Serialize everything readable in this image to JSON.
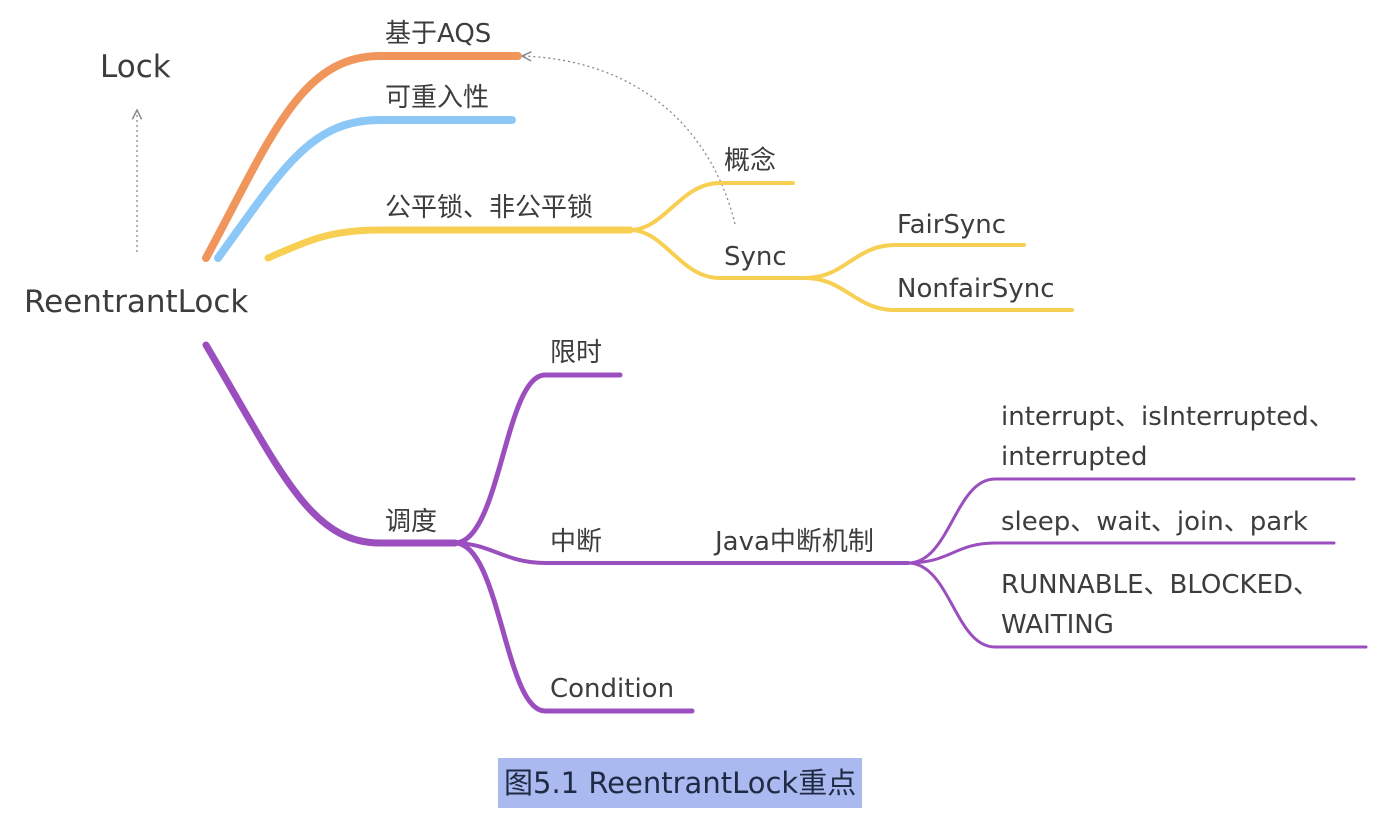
{
  "diagram": {
    "root": "ReentrantLock",
    "parent": "Lock",
    "branches": {
      "aqs": "基于AQS",
      "reentrant": "可重入性",
      "fairness": {
        "label": "公平锁、非公平锁",
        "concept": "概念",
        "sync": "Sync",
        "fair_sync": "FairSync",
        "nonfair_sync": "NonfairSync"
      },
      "scheduling": {
        "label": "调度",
        "timed": "限时",
        "interrupt": "中断",
        "interrupt_mechanism": "Java中断机制",
        "methods_line1": "interrupt、isInterrupted、",
        "methods_line2": "interrupted",
        "blocking": "sleep、wait、join、park",
        "states_line1": "RUNNABLE、BLOCKED、",
        "states_line2": "WAITING",
        "condition": "Condition"
      }
    },
    "colors": {
      "orange": "#f0965c",
      "blue": "#8cc8f7",
      "yellow": "#f7cf52",
      "purple": "#9b4fbf",
      "text": "#3d3d3d",
      "arrow": "#8a8a8a",
      "caption_bg": "#aab9ef"
    }
  },
  "caption": "图5.1 ReentrantLock重点"
}
